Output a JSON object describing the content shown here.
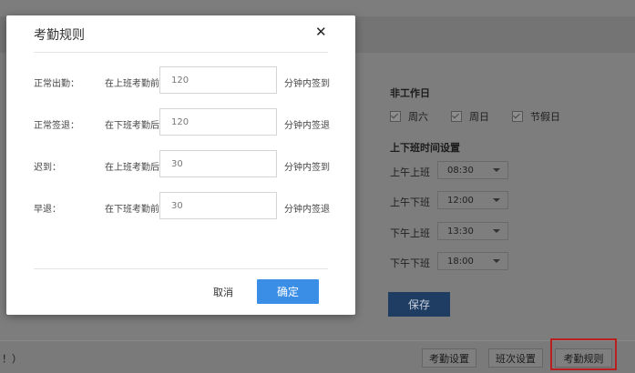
{
  "background": {
    "non_work_title": "非工作日",
    "non_work_days": [
      {
        "label": "周六",
        "checked": true
      },
      {
        "label": "周日",
        "checked": true
      },
      {
        "label": "节假日",
        "checked": true
      }
    ],
    "time_title": "上下班时间设置",
    "times": [
      {
        "label": "上午上班",
        "value": "08:30"
      },
      {
        "label": "上午下班",
        "value": "12:00"
      },
      {
        "label": "下午上班",
        "value": "13:30"
      },
      {
        "label": "下午下班",
        "value": "18:00"
      }
    ],
    "save_label": "保存",
    "footer_left_text": "！）",
    "footer_buttons": [
      "考勤设置",
      "班次设置",
      "考勤规则"
    ]
  },
  "modal": {
    "title": "考勤规则",
    "close_icon": "close-icon",
    "rows": [
      {
        "label": "正常出勤：",
        "hint": "在上班考勤前",
        "value": "120",
        "suffix": "分钟内签到"
      },
      {
        "label": "正常签退：",
        "hint": "在下班考勤后",
        "value": "120",
        "suffix": "分钟内签退"
      },
      {
        "label": "迟到：",
        "hint": "在上班考勤后",
        "value": "30",
        "suffix": "分钟内签到"
      },
      {
        "label": "早退：",
        "hint": "在下班考勤前",
        "value": "30",
        "suffix": "分钟内签退"
      }
    ],
    "cancel_label": "取消",
    "ok_label": "确定",
    "ok_color": "#3b8ee6"
  }
}
